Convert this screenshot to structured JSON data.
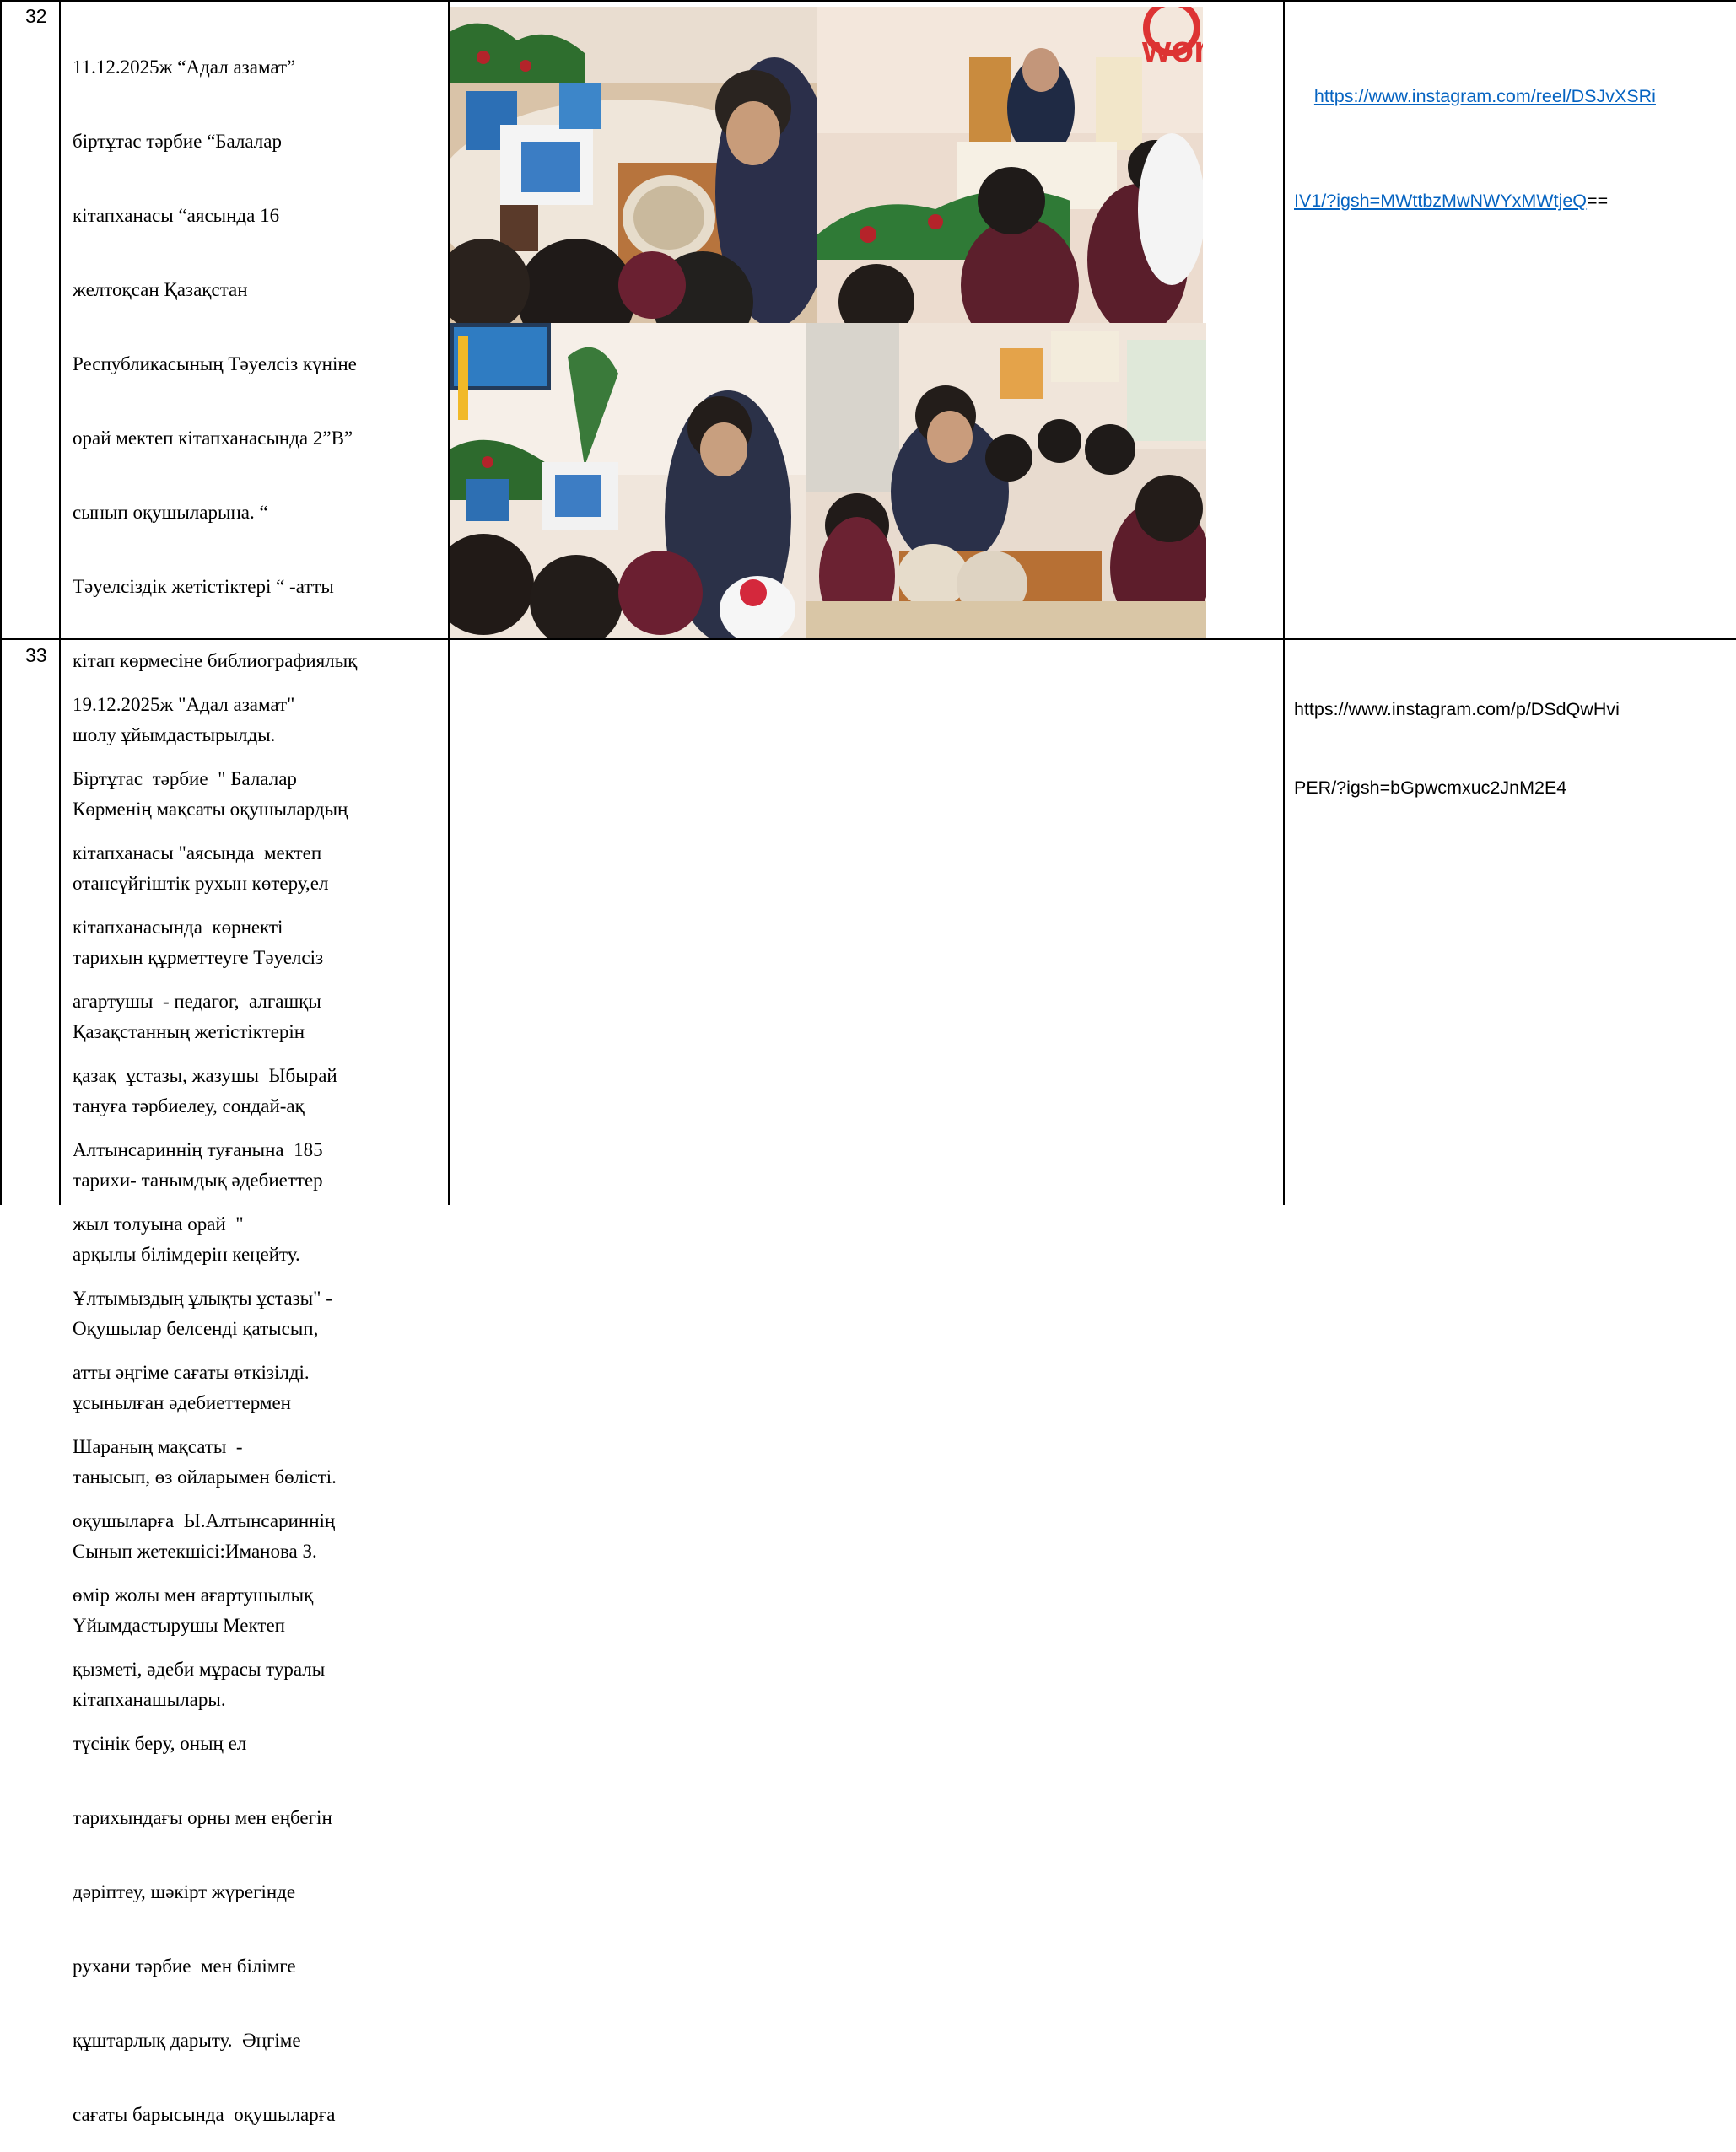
{
  "rows": [
    {
      "number": "32",
      "description_lines": [
        "11.12.2025ж “Адал азамат”",
        "біртұтас тәрбие “Балалар",
        "кітапханасы “аясында 16",
        "желтоқсан Қазақстан",
        "Республикасының Тәуелсіз күніне",
        "орай мектеп кітапханасында 2”В”",
        "сынып оқушыларына. “",
        "Тәуелсіздік жетістіктері “ -атты",
        "кітап көрмесіне библиографиялық",
        "шолу ұйымдастырылды.",
        "Көрменің мақсаты оқушылардың",
        "отансүйгіштік рухын көтеру,ел",
        "тарихын құрметтеуге Тәуелсіз",
        "Қазақстанның жетістіктерін",
        "тануға тәрбиелеу, сондай-ақ",
        "тарихи- танымдық әдебиеттер",
        "арқылы білімдерін кеңейту.",
        "Оқушылар белсенді қатысып,",
        "ұсынылған әдебиеттермен",
        "танысып, өз ойларымен бөлісті.",
        "Сынып жетекшісі:Иманова З.",
        "Ұйымдастырушы Мектеп",
        "кітапханашылары."
      ],
      "link_line1": "https://www.instagram.com/reel/DSJvXSRi",
      "link_line2": "IV1/?igsh=MWttbzMwNWYxMWtjeQ",
      "link_suffix": "==",
      "photos": [
        "classroom-photo-book-display",
        "classroom-photo-librarian-speaking",
        "classroom-photo-students-exhibition",
        "classroom-photo-teacher-showing-books"
      ]
    },
    {
      "number": "33",
      "description_lines": [
        "19.12.2025ж \"Адал азамат\"",
        "Біртұтас  тәрбие  \" Балалар",
        "кітапханасы \"аясында  мектеп",
        "кітапханасында  көрнекті",
        "ағартушы  - педагог,  алғашқы",
        "қазақ  ұстазы, жазушы  Ыбырай",
        "Алтынсариннің туғанына  185",
        "жыл толуына орай  \"",
        "Ұлтымыздың ұлықты ұстазы\" -",
        "атты әңгіме сағаты өткізілді.",
        "Шараның мақсаты  -",
        "оқушыларға  Ы.Алтынсариннің",
        "өмір жолы мен ағартушылық",
        "қызметі, әдеби мұрасы туралы",
        "түсінік беру, оның ел",
        "тарихындағы орны мен еңбегін",
        "дәріптеу, шәкірт жүрегінде",
        "рухани тәрбие  мен білімге",
        "құштарлық дарыту.  Әңгіме",
        "сағаты барысында  оқушыларға"
      ],
      "link_line1": "https://www.instagram.com/p/DSdQwHvi",
      "link_line2": "PER/?igsh=bGpwcmxuc2JnM2E4"
    }
  ],
  "colors": {
    "border": "#000000",
    "link": "#0563C1",
    "text": "#000000"
  }
}
